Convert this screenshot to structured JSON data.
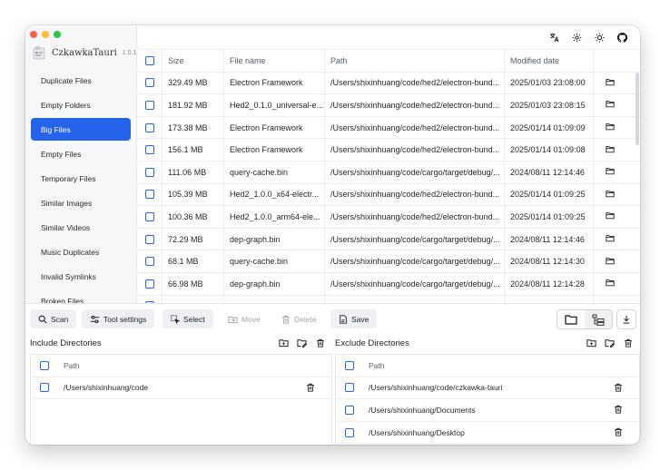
{
  "app": {
    "title": "CzkawkaTauri",
    "version": "1.0.1"
  },
  "colors": {
    "accent": "#2563eb",
    "traffic_red": "#ff5f57",
    "traffic_yellow": "#febc2e",
    "traffic_green": "#28c840"
  },
  "sidebar": {
    "items": [
      {
        "label": "Duplicate Files",
        "active": false
      },
      {
        "label": "Empty Folders",
        "active": false
      },
      {
        "label": "Big Files",
        "active": true
      },
      {
        "label": "Empty Files",
        "active": false
      },
      {
        "label": "Temporary Files",
        "active": false
      },
      {
        "label": "Similar Images",
        "active": false
      },
      {
        "label": "Similar Videos",
        "active": false
      },
      {
        "label": "Music Duplicates",
        "active": false
      },
      {
        "label": "Invalid Symlinks",
        "active": false
      },
      {
        "label": "Broken Files",
        "active": false
      }
    ]
  },
  "topbar": {
    "icons": [
      "translate-icon",
      "settings-icon",
      "theme-sun-icon",
      "github-icon"
    ]
  },
  "table": {
    "headers": {
      "size": "Size",
      "name": "File name",
      "path": "Path",
      "date": "Modified date"
    },
    "rows": [
      {
        "size": "329.49 MB",
        "name": "Electron Framework",
        "path": "/Users/shixinhuang/code/hed2/electron-bund...",
        "date": "2025/01/03 23:08:00"
      },
      {
        "size": "181.92 MB",
        "name": "Hed2_0.1.0_universal-e...",
        "path": "/Users/shixinhuang/code/hed2/electron-bund...",
        "date": "2025/01/03 23:08:15"
      },
      {
        "size": "173.38 MB",
        "name": "Electron Framework",
        "path": "/Users/shixinhuang/code/hed2/electron-bund...",
        "date": "2025/01/14 01:09:09"
      },
      {
        "size": "156.1 MB",
        "name": "Electron Framework",
        "path": "/Users/shixinhuang/code/hed2/electron-bund...",
        "date": "2025/01/14 01:09:08"
      },
      {
        "size": "111.06 MB",
        "name": "query-cache.bin",
        "path": "/Users/shixinhuang/code/cargo/target/debug/...",
        "date": "2024/08/11 12:14:46"
      },
      {
        "size": "105.39 MB",
        "name": "Hed2_1.0.0_x64-electr...",
        "path": "/Users/shixinhuang/code/hed2/electron-bund...",
        "date": "2025/01/14 01:09:25"
      },
      {
        "size": "100.36 MB",
        "name": "Hed2_1.0.0_arm64-ele...",
        "path": "/Users/shixinhuang/code/hed2/electron-bund...",
        "date": "2025/01/14 01:09:25"
      },
      {
        "size": "72.29 MB",
        "name": "dep-graph.bin",
        "path": "/Users/shixinhuang/code/cargo/target/debug/...",
        "date": "2024/08/11 12:14:46"
      },
      {
        "size": "68.1 MB",
        "name": "query-cache.bin",
        "path": "/Users/shixinhuang/code/cargo/target/debug/...",
        "date": "2024/08/11 12:14:30"
      },
      {
        "size": "66.98 MB",
        "name": "dep-graph.bin",
        "path": "/Users/shixinhuang/code/cargo/target/debug/...",
        "date": "2024/08/11 12:14:28"
      },
      {
        "size": "",
        "name": "",
        "path": "",
        "date": ""
      }
    ]
  },
  "toolbar": {
    "scan": "Scan",
    "tool_settings": "Tool settings",
    "select": "Select",
    "move": "Move",
    "delete": "Delete",
    "save": "Save"
  },
  "include": {
    "title": "Include Directories",
    "header": "Path",
    "rows": [
      "/Users/shixinhuang/code"
    ]
  },
  "exclude": {
    "title": "Exclude Directories",
    "header": "Path",
    "rows": [
      "/Users/shixinhuang/code/czkawka-tauri",
      "/Users/shixinhuang/Documents",
      "/Users/shixinhuang/Desktop"
    ]
  }
}
